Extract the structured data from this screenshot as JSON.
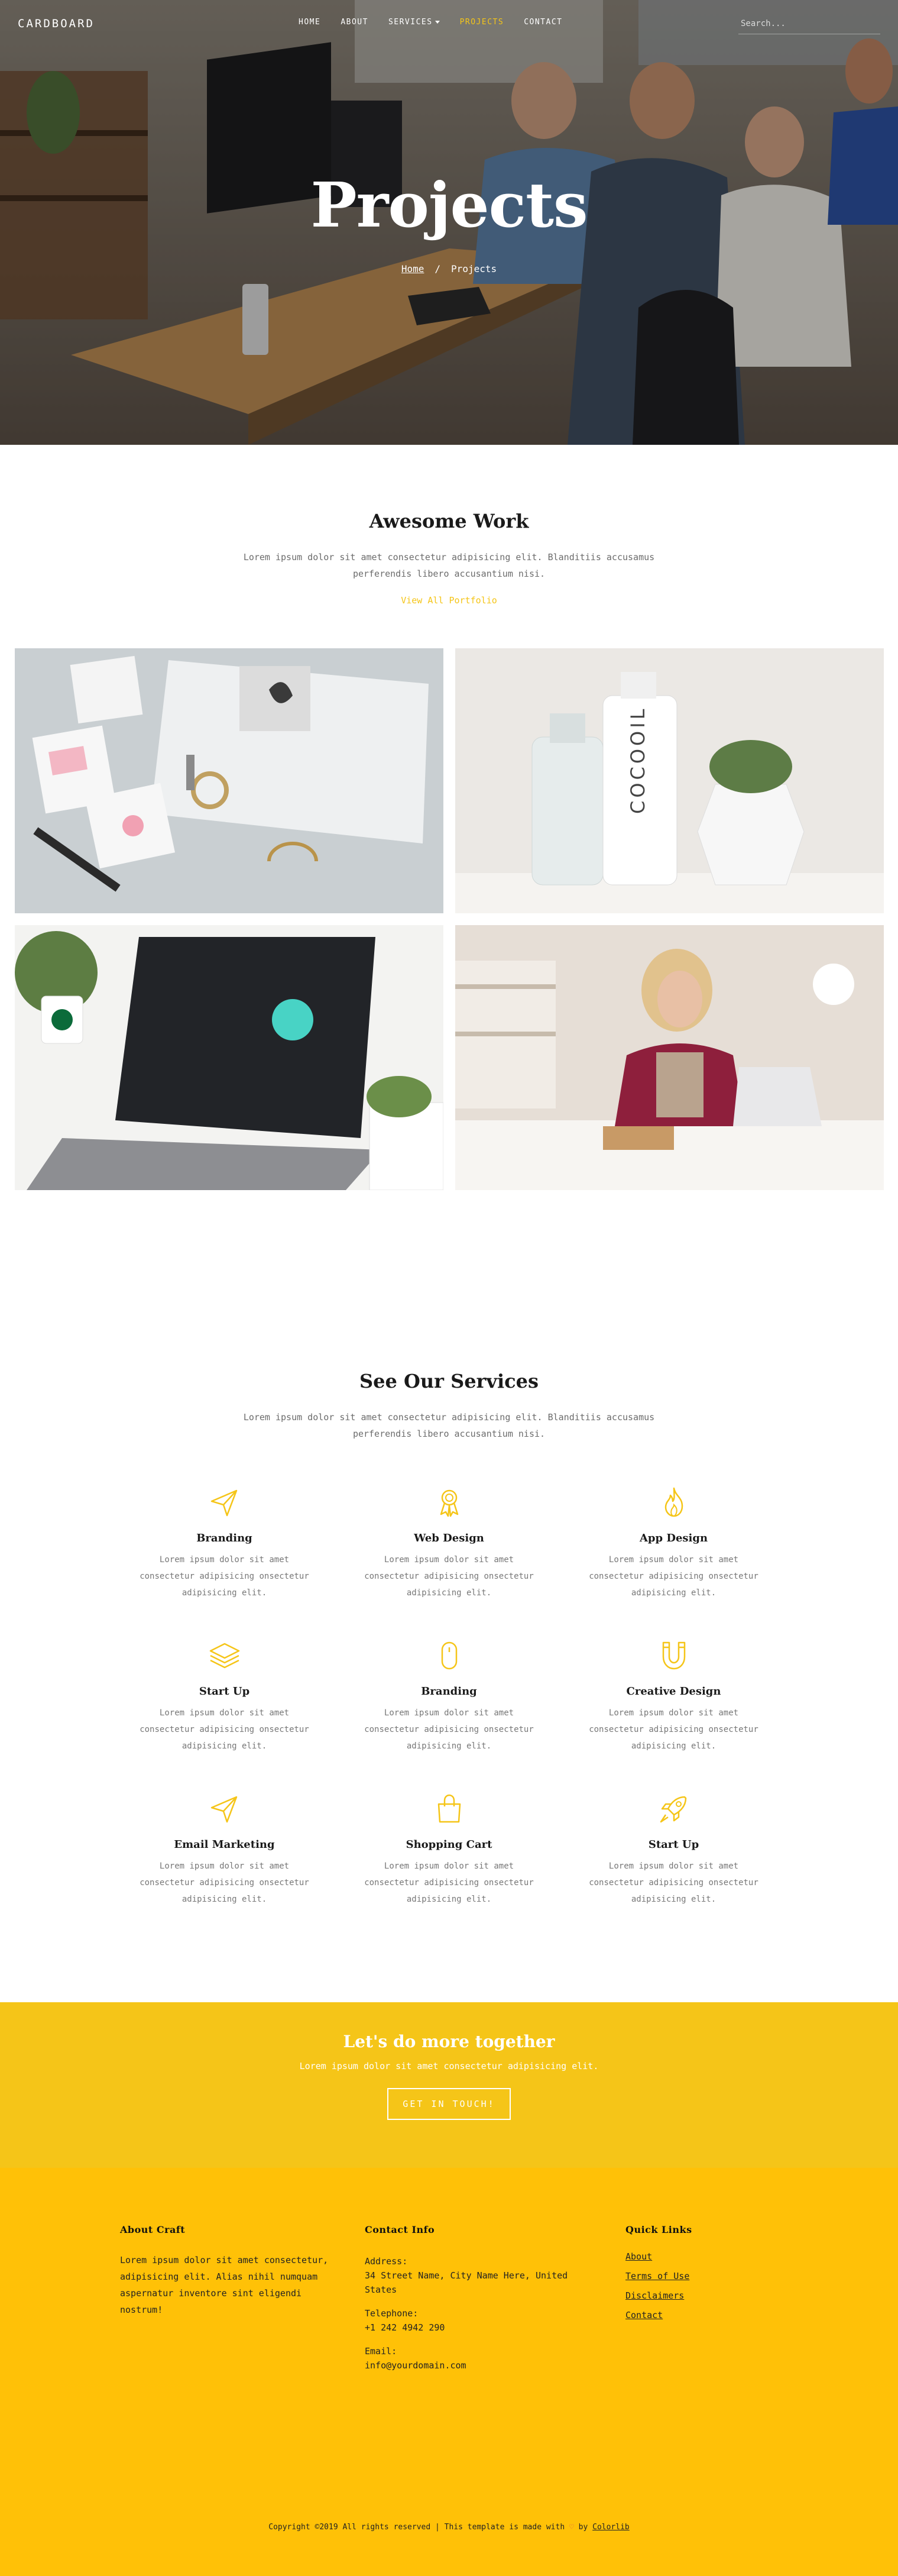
{
  "header": {
    "logo": "CARDBOARD",
    "nav": [
      {
        "label": "HOME",
        "active": false,
        "dropdown": false
      },
      {
        "label": "ABOUT",
        "active": false,
        "dropdown": false
      },
      {
        "label": "SERVICES",
        "active": false,
        "dropdown": true
      },
      {
        "label": "PROJECTS",
        "active": true,
        "dropdown": false
      },
      {
        "label": "CONTACT",
        "active": false,
        "dropdown": false
      }
    ],
    "search_placeholder": "Search..."
  },
  "hero": {
    "title": "Projects",
    "breadcrumb_home": "Home",
    "breadcrumb_sep": "/",
    "breadcrumb_current": "Projects"
  },
  "work": {
    "title": "Awesome Work",
    "text": "Lorem ipsum dolor sit amet consectetur adipisicing elit. Blanditiis accusamus perferendis libero accusantium nisi.",
    "view_all": "View All Portfolio",
    "tiles": [
      "stationery-flatlay",
      "cocooil-bottles",
      "laptop-desk",
      "woman-at-desk"
    ]
  },
  "services": {
    "title": "See Our Services",
    "text": "Lorem ipsum dolor sit amet consectetur adipisicing elit. Blanditiis accusamus perferendis libero accusantium nisi.",
    "items": [
      {
        "title": "Branding",
        "text": "Lorem ipsum dolor sit amet consectetur adipisicing onsectetur adipisicing elit.",
        "icon": "paper-plane-icon"
      },
      {
        "title": "Web Design",
        "text": "Lorem ipsum dolor sit amet consectetur adipisicing onsectetur adipisicing elit.",
        "icon": "award-ribbon-icon"
      },
      {
        "title": "App Design",
        "text": "Lorem ipsum dolor sit amet consectetur adipisicing onsectetur adipisicing elit.",
        "icon": "flame-icon"
      },
      {
        "title": "Start Up",
        "text": "Lorem ipsum dolor sit amet consectetur adipisicing onsectetur adipisicing elit.",
        "icon": "layers-icon"
      },
      {
        "title": "Branding",
        "text": "Lorem ipsum dolor sit amet consectetur adipisicing onsectetur adipisicing elit.",
        "icon": "mouse-icon"
      },
      {
        "title": "Creative Design",
        "text": "Lorem ipsum dolor sit amet consectetur adipisicing onsectetur adipisicing elit.",
        "icon": "magnet-icon"
      },
      {
        "title": "Email Marketing",
        "text": "Lorem ipsum dolor sit amet consectetur adipisicing onsectetur adipisicing elit.",
        "icon": "paper-plane-icon"
      },
      {
        "title": "Shopping Cart",
        "text": "Lorem ipsum dolor sit amet consectetur adipisicing onsectetur adipisicing elit.",
        "icon": "shopping-bag-icon"
      },
      {
        "title": "Start Up",
        "text": "Lorem ipsum dolor sit amet consectetur adipisicing onsectetur adipisicing elit.",
        "icon": "rocket-icon"
      }
    ]
  },
  "cta": {
    "title": "Let's do more together",
    "text": "Lorem ipsum dolor sit amet consectetur adipisicing elit.",
    "button": "GET IN TOUCH!"
  },
  "footer": {
    "about_title": "About Craft",
    "about_text": "Lorem ipsum dolor sit amet consectetur, adipisicing elit. Alias nihil numquam aspernatur inventore sint eligendi nostrum!",
    "contact_title": "Contact Info",
    "address_label": "Address:",
    "address_value": "34 Street Name, City Name Here, United States",
    "telephone_label": "Telephone:",
    "telephone_value": "+1 242 4942 290",
    "email_label": "Email:",
    "email_value": "info@yourdomain.com",
    "links_title": "Quick Links",
    "links": [
      "About",
      "Terms of Use",
      "Disclaimers",
      "Contact"
    ],
    "copyright_text": "Copyright ©2019 All rights reserved | This template is made with",
    "copyright_heart": "♡",
    "copyright_by": "by",
    "copyright_link": "Colorlib"
  },
  "colors": {
    "accent": "#f5c518",
    "footer_bg": "#ffc107",
    "cta_bg": "#f5c518"
  }
}
